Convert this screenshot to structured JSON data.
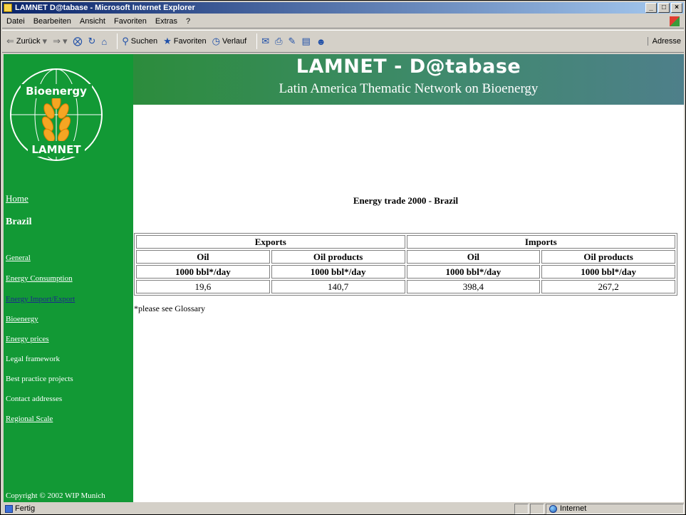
{
  "window": {
    "title": "LAMNET D@tabase - Microsoft Internet Explorer",
    "controls": [
      "_",
      "□",
      "×"
    ]
  },
  "menubar": {
    "items": [
      "Datei",
      "Bearbeiten",
      "Ansicht",
      "Favoriten",
      "Extras",
      "?"
    ]
  },
  "toolbar": {
    "back_label": "Zurück",
    "search_label": "Suchen",
    "favorites_label": "Favoriten",
    "history_label": "Verlauf",
    "address_label": "Adresse"
  },
  "site": {
    "logo_top_text": "Bioenergy",
    "logo_bottom_text": "LAMNET",
    "title": "LAMNET - D@tabase",
    "subtitle": "Latin America Thematic Network on Bioenergy"
  },
  "sidebar": {
    "home": "Home",
    "country": "Brazil",
    "items": [
      {
        "label": "General"
      },
      {
        "label": "Energy Consumption"
      },
      {
        "label": "Energy Import/Export"
      },
      {
        "label": "Bioenergy"
      },
      {
        "label": "Energy prices"
      },
      {
        "label": "Legal framework"
      },
      {
        "label": "Best practice projects"
      },
      {
        "label": "Contact addresses"
      },
      {
        "label": "Regional Scale"
      }
    ],
    "copyright": "Copyright © 2002 WIP Munich"
  },
  "main": {
    "heading": "Energy trade 2000 - Brazil",
    "table": {
      "groups": [
        "Exports",
        "Imports"
      ],
      "columns": [
        "Oil",
        "Oil products",
        "Oil",
        "Oil products"
      ],
      "units": [
        "1000 bbl*/day",
        "1000 bbl*/day",
        "1000 bbl*/day",
        "1000 bbl*/day"
      ],
      "values": [
        "19,6",
        "140,7",
        "398,4",
        "267,2"
      ]
    },
    "footnote": "*please see Glossary"
  },
  "statusbar": {
    "status": "Fertig",
    "zone": "Internet"
  },
  "colors": {
    "sidebar_green": "#129935",
    "banner_left": "#2c8c3c",
    "banner_right": "#4e7f8a",
    "visited_link": "#1b2a8a"
  }
}
